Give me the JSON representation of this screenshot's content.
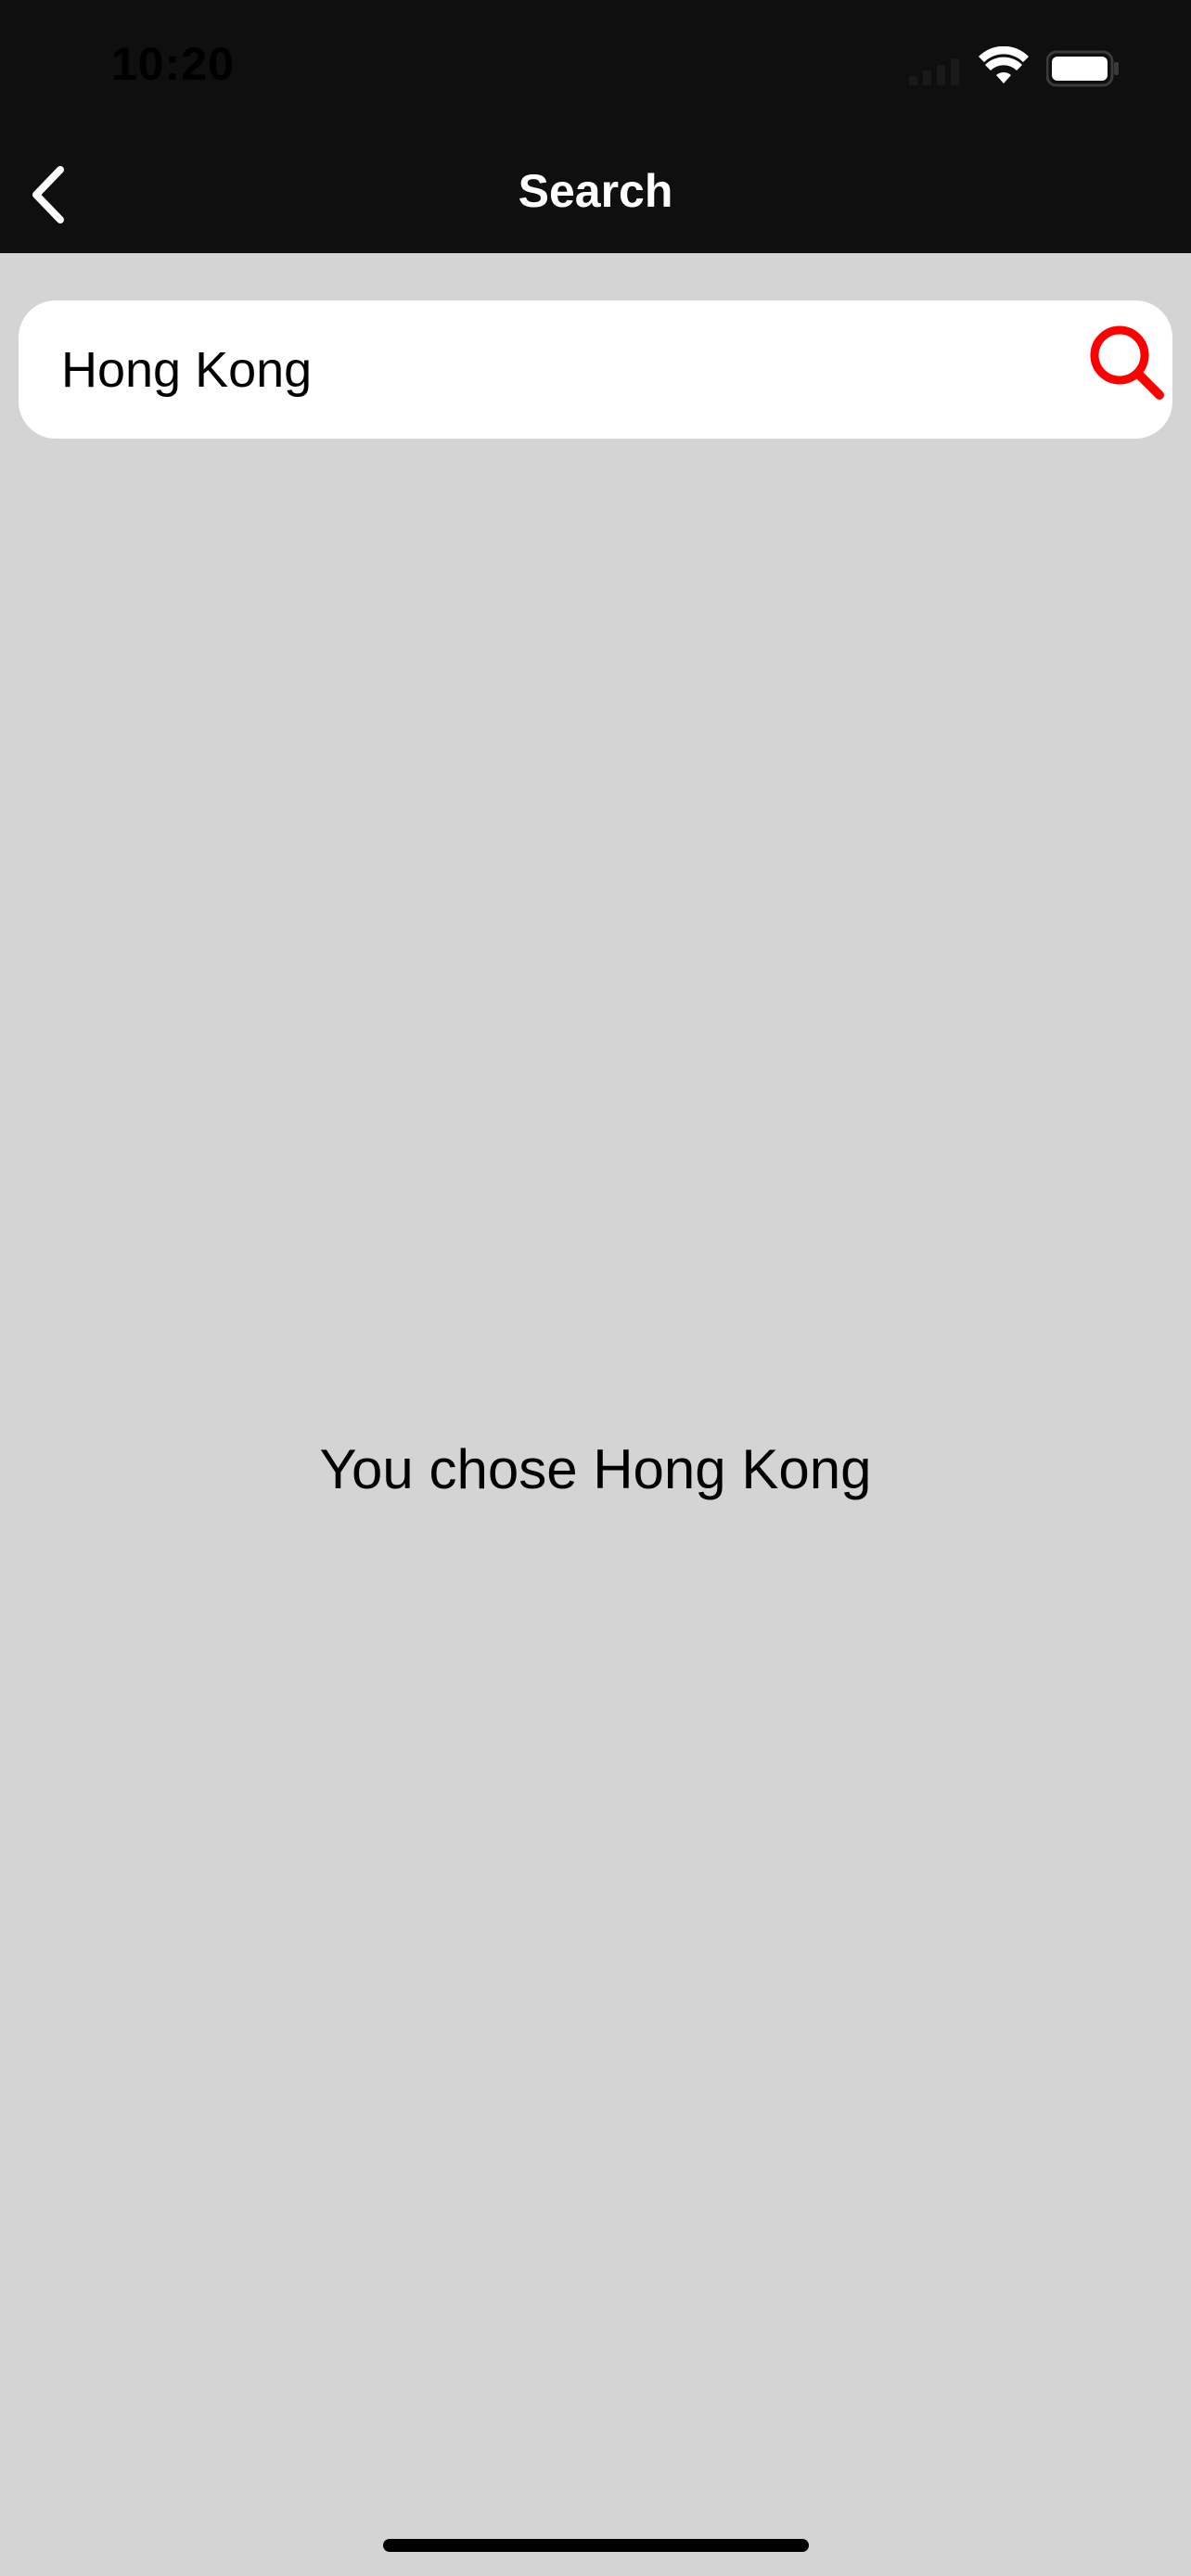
{
  "status_bar": {
    "time": "10:20",
    "icons": [
      "signal-icon",
      "wifi-icon",
      "battery-icon"
    ]
  },
  "nav": {
    "title": "Search",
    "back_icon": "chevron-left-icon"
  },
  "search": {
    "value": "Hong Kong",
    "icon": "search-icon",
    "accent_color": "#ff0000"
  },
  "result": {
    "message": "You chose Hong Kong"
  },
  "colors": {
    "background": "#d4d4d4",
    "header": "#0f0f0f",
    "header_text": "#ffffff"
  }
}
